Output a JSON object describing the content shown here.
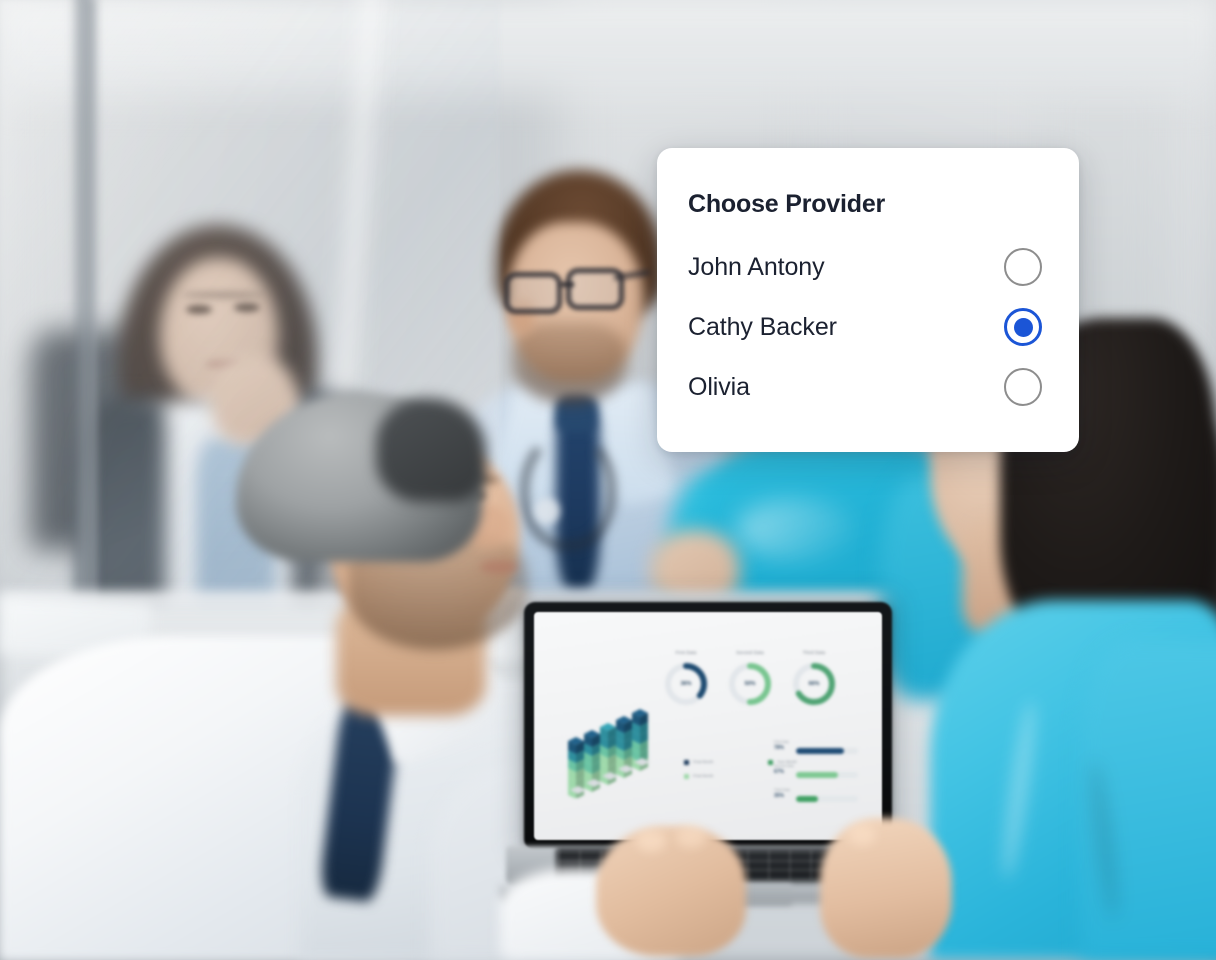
{
  "scene": {
    "description": "Blurred photo of medical team in a meeting room with a laptop showing a dashboard",
    "colors": {
      "scrubs_teal": "#2ab4da",
      "doctor_shirt_blue": "#bed0e2",
      "tie_navy": "#1d3a60",
      "table_gray": "#dfe3e6",
      "wall_gray": "#d2d6d9"
    }
  },
  "card": {
    "title": "Choose Provider",
    "accent_color": "#1b55d6",
    "unselected_color": "#8d8d8d",
    "text_color": "#1b2130",
    "background": "#ffffff",
    "options": [
      {
        "label": "John Antony",
        "selected": false,
        "radio_icon": "radio-unchecked-icon"
      },
      {
        "label": "Cathy Backer",
        "selected": true,
        "radio_icon": "radio-checked-icon"
      },
      {
        "label": "Olivia",
        "selected": false,
        "radio_icon": "radio-unchecked-icon"
      }
    ]
  },
  "laptop_dashboard": {
    "donuts": [
      {
        "label": "First Data",
        "value": "36%",
        "pct": 36,
        "color": "#1d4a70"
      },
      {
        "label": "Second Data",
        "value": "50%",
        "pct": 50,
        "color": "#77c58f"
      },
      {
        "label": "Third Data",
        "value": "66%",
        "pct": 66,
        "color": "#4fa373"
      }
    ],
    "legend": [
      {
        "label": "Final Month",
        "color": "#1b3a5c"
      },
      {
        "label": "Your Month",
        "color": "#3f9e63"
      },
      {
        "label": "Final Month",
        "color": "#9ed8a8"
      }
    ],
    "bars": [
      {
        "label": "First Data",
        "value": "78%",
        "pct": 78,
        "color": "#1d4a74"
      },
      {
        "label": "Second Data",
        "value": "67%",
        "pct": 67,
        "color": "#7cc891"
      },
      {
        "label": "Third Data",
        "value": "35%",
        "pct": 35,
        "color": "#3fa062"
      }
    ],
    "iso_chart": {
      "type": "isometric-stacked-bar",
      "colors": [
        "#9fd9ab",
        "#6bc4a4",
        "#2f8f9e",
        "#1d5578",
        "#143a5c"
      ]
    }
  }
}
